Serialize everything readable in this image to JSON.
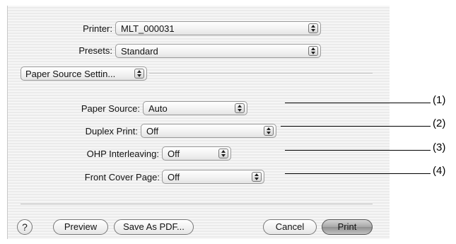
{
  "printer": {
    "label": "Printer:",
    "value": "MLT_000031"
  },
  "presets": {
    "label": "Presets:",
    "value": "Standard"
  },
  "panel_selector": {
    "value": "Paper Source Settin..."
  },
  "settings": [
    {
      "label": "Paper Source:",
      "value": "Auto",
      "callout": "(1)"
    },
    {
      "label": "Duplex Print:",
      "value": "Off",
      "callout": "(2)"
    },
    {
      "label": "OHP Interleaving:",
      "value": "Off",
      "callout": "(3)"
    },
    {
      "label": "Front Cover Page:",
      "value": "Off",
      "callout": "(4)"
    }
  ],
  "buttons": {
    "help": "?",
    "preview": "Preview",
    "save_as_pdf": "Save As PDF...",
    "cancel": "Cancel",
    "print": "Print"
  },
  "icons": {
    "popup_arrows": "updown-arrows-icon",
    "help": "question-mark-icon"
  }
}
